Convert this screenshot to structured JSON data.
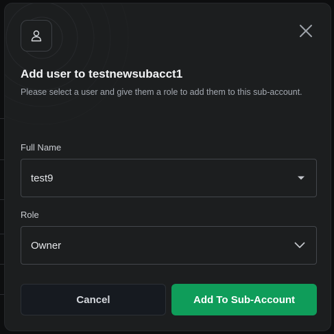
{
  "modal": {
    "title": "Add user to testnewsubacct1",
    "subtitle": "Please select a user and give them a role to add them to this sub-account.",
    "icon": "user-icon",
    "close_icon": "close-icon"
  },
  "form": {
    "full_name": {
      "label": "Full Name",
      "value": "test9",
      "icon": "caret-down-icon"
    },
    "role": {
      "label": "Role",
      "value": "Owner",
      "icon": "chevron-down-icon"
    }
  },
  "actions": {
    "cancel_label": "Cancel",
    "submit_label": "Add To Sub-Account"
  },
  "colors": {
    "primary": "#0f9d5a",
    "modal_background": "#1c1e1f",
    "page_background": "#0d0e0f"
  }
}
